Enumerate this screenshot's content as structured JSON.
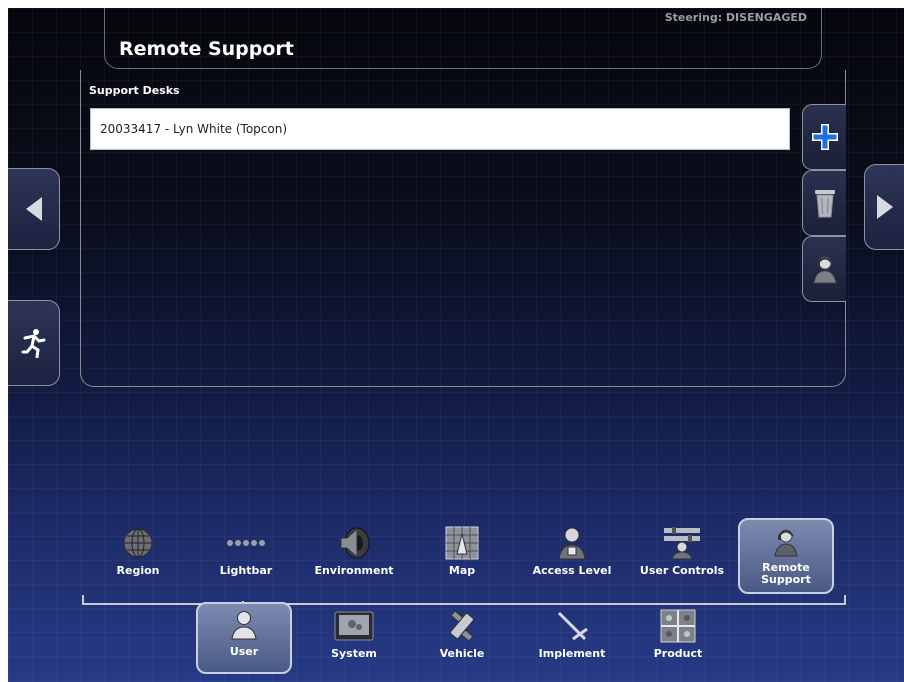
{
  "status": {
    "steering": "Steering: DISENGAGED"
  },
  "page": {
    "title": "Remote Support"
  },
  "support_desks": {
    "label": "Support Desks",
    "items": [
      {
        "text": "20033417 - Lyn White (Topcon)"
      }
    ]
  },
  "actions": {
    "add_icon": "plus-icon",
    "delete_icon": "trash-icon",
    "contact_icon": "support-person-icon"
  },
  "side_nav": {
    "prev_icon": "left-arrow-icon",
    "next_icon": "right-arrow-icon",
    "exit_icon": "exit-runner-icon"
  },
  "sub_menu": [
    {
      "label": "Region",
      "icon": "globe-icon"
    },
    {
      "label": "Lightbar",
      "icon": "lightbar-icon"
    },
    {
      "label": "Environment",
      "icon": "speaker-icon"
    },
    {
      "label": "Map",
      "icon": "map-icon"
    },
    {
      "label": "Access Level",
      "icon": "user-badge-icon"
    },
    {
      "label": "User Controls",
      "icon": "user-controls-icon"
    },
    {
      "label": "Remote Support",
      "icon": "support-person-icon",
      "selected": true
    }
  ],
  "main_menu": [
    {
      "label": "User",
      "icon": "user-icon",
      "selected": true
    },
    {
      "label": "System",
      "icon": "console-icon"
    },
    {
      "label": "Vehicle",
      "icon": "satellite-icon"
    },
    {
      "label": "Implement",
      "icon": "implement-icon"
    },
    {
      "label": "Product",
      "icon": "product-icon"
    }
  ],
  "colors": {
    "accent_blue": "#1f6fe0",
    "panel_border": "#8a8c94",
    "selected_tab": "#5e6d98"
  }
}
